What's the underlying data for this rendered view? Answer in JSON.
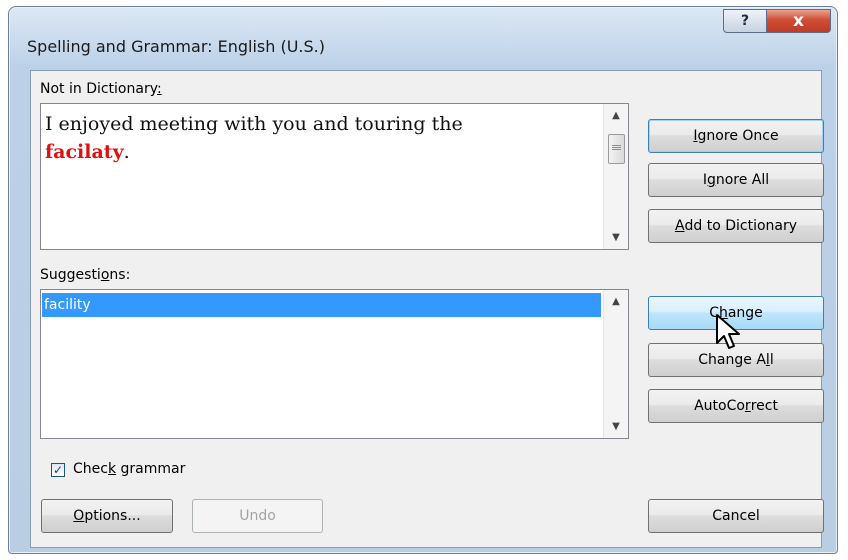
{
  "window": {
    "title": "Spelling and Grammar: English (U.S.)",
    "help_glyph": "?",
    "close_glyph": "x"
  },
  "not_in_dictionary": {
    "label_pre": "Not in Dictionary",
    "label_colon": ":",
    "sentence_pre": "I enjoyed meeting with you and touring the",
    "error_word": "facilaty",
    "sentence_post": "."
  },
  "buttons": {
    "ignore_once_pre": "",
    "ignore_once_u": "I",
    "ignore_once_post": "gnore Once",
    "ignore_all_pre": "I",
    "ignore_all_u": "g",
    "ignore_all_post": "nore All",
    "add_dict_u": "A",
    "add_dict_post": "dd to Dictionary",
    "change_pre": "C",
    "change_u": "h",
    "change_post": "ange",
    "change_all_pre": "Change A",
    "change_all_u": "l",
    "change_all_post": "l",
    "autocorrect_pre": "AutoCo",
    "autocorrect_u": "r",
    "autocorrect_post": "rect",
    "options_u": "O",
    "options_post": "ptions...",
    "undo": "Undo",
    "cancel": "Cancel"
  },
  "suggestions": {
    "label_pre": "Suggesti",
    "label_u": "o",
    "label_post": "ns:",
    "items": [
      "facility"
    ]
  },
  "check_grammar": {
    "checked": true,
    "mark": "✓",
    "label_pre": "Chec",
    "label_u": "k",
    "label_post": " grammar"
  },
  "icons": [
    "help-icon",
    "close-icon",
    "scroll-up-arrow-icon",
    "scroll-down-arrow-icon",
    "mouse-cursor-icon",
    "checkbox-check-icon"
  ]
}
